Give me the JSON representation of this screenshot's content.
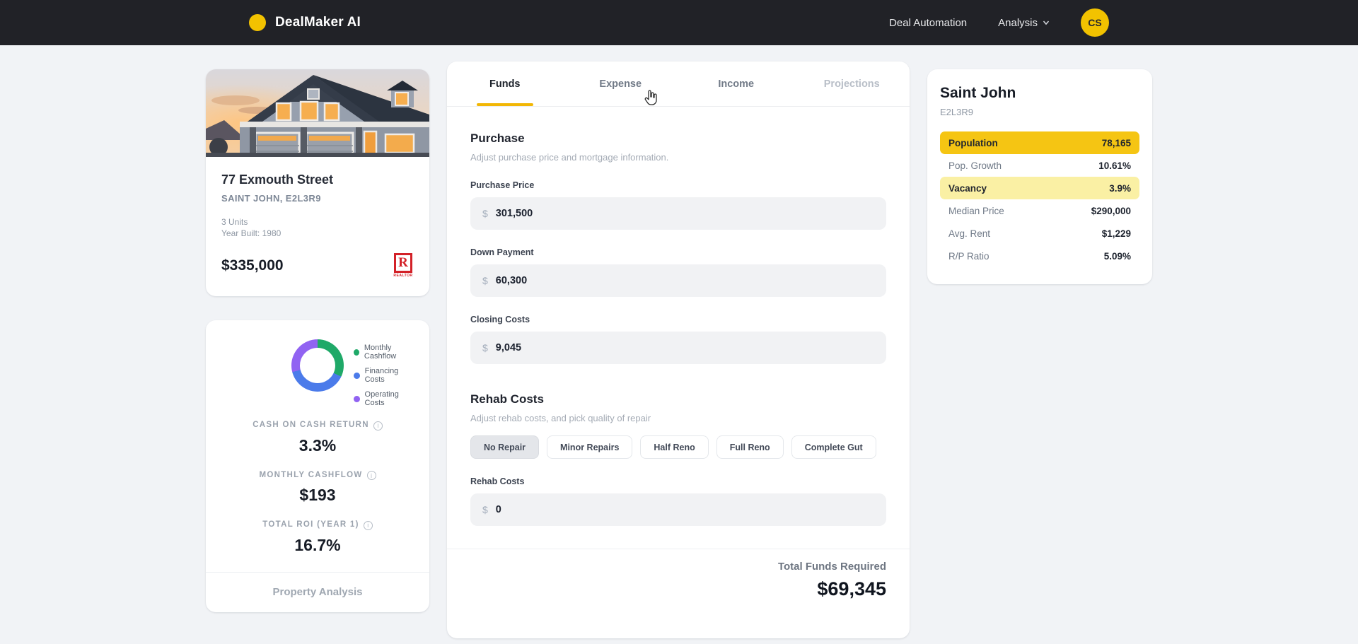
{
  "navbar": {
    "brand": "DealMaker AI",
    "items": [
      {
        "label": "Deal Automation"
      },
      {
        "label": "Analysis"
      }
    ],
    "avatar_initials": "CS",
    "accent_color": "#F2C200"
  },
  "property_card": {
    "address": "77 Exmouth Street",
    "city_postal": "SAINT JOHN, E2L3R9",
    "units": "3 Units",
    "year_built": "Year Built: 1980",
    "price": "$335,000",
    "realtor_logo": {
      "letter": "R",
      "caption": "REALTOR"
    }
  },
  "analysis_card": {
    "metrics": [
      {
        "label": "CASH ON CASH RETURN",
        "value": "3.3%"
      },
      {
        "label": "MONTHLY CASHFLOW",
        "value": "$193"
      },
      {
        "label": "TOTAL ROI (YEAR 1)",
        "value": "16.7%"
      }
    ],
    "info_icon": "i",
    "footer_link": "Property Analysis"
  },
  "chart_data": {
    "type": "pie",
    "style": "donut",
    "title": "",
    "legend_position": "right",
    "series": [
      {
        "name": "Monthly Cashflow",
        "pct": 32,
        "color": "#1FA968"
      },
      {
        "name": "Financing Costs",
        "pct": 39,
        "color": "#4B7BEA"
      },
      {
        "name": "Operating Costs",
        "pct": 29,
        "color": "#9163F2"
      }
    ]
  },
  "tabs": [
    {
      "label": "Funds",
      "active": true
    },
    {
      "label": "Expense",
      "active": false
    },
    {
      "label": "Income",
      "active": false
    },
    {
      "label": "Projections",
      "active": false
    }
  ],
  "funds": {
    "purchase": {
      "title": "Purchase",
      "subtitle": "Adjust purchase price and mortgage information.",
      "fields": [
        {
          "label": "Purchase Price",
          "prefix": "$",
          "value": "301,500"
        },
        {
          "label": "Down Payment",
          "prefix": "$",
          "value": "60,300"
        },
        {
          "label": "Closing Costs",
          "prefix": "$",
          "value": "9,045"
        }
      ]
    },
    "rehab": {
      "title": "Rehab Costs",
      "subtitle": "Adjust rehab costs, and pick quality of repair",
      "options": [
        "No Repair",
        "Minor Repairs",
        "Half Reno",
        "Full Reno",
        "Complete Gut"
      ],
      "selected_option": "No Repair",
      "field": {
        "label": "Rehab Costs",
        "prefix": "$",
        "value": "0"
      }
    },
    "total": {
      "label": "Total Funds Required",
      "value": "$69,345"
    }
  },
  "market_card": {
    "title": "Saint John",
    "subtitle": "E2L3R9",
    "rows": [
      {
        "label": "Population",
        "value": "78,165",
        "highlight": "strong"
      },
      {
        "label": "Pop. Growth",
        "value": "10.61%",
        "highlight": "none"
      },
      {
        "label": "Vacancy",
        "value": "3.9%",
        "highlight": "light"
      },
      {
        "label": "Median Price",
        "value": "$290,000",
        "highlight": "none"
      },
      {
        "label": "Avg. Rent",
        "value": "$1,229",
        "highlight": "none"
      },
      {
        "label": "R/P Ratio",
        "value": "5.09%",
        "highlight": "none"
      }
    ],
    "highlight_strong_color": "#F5C513",
    "highlight_light_color": "#FAF0A4"
  }
}
